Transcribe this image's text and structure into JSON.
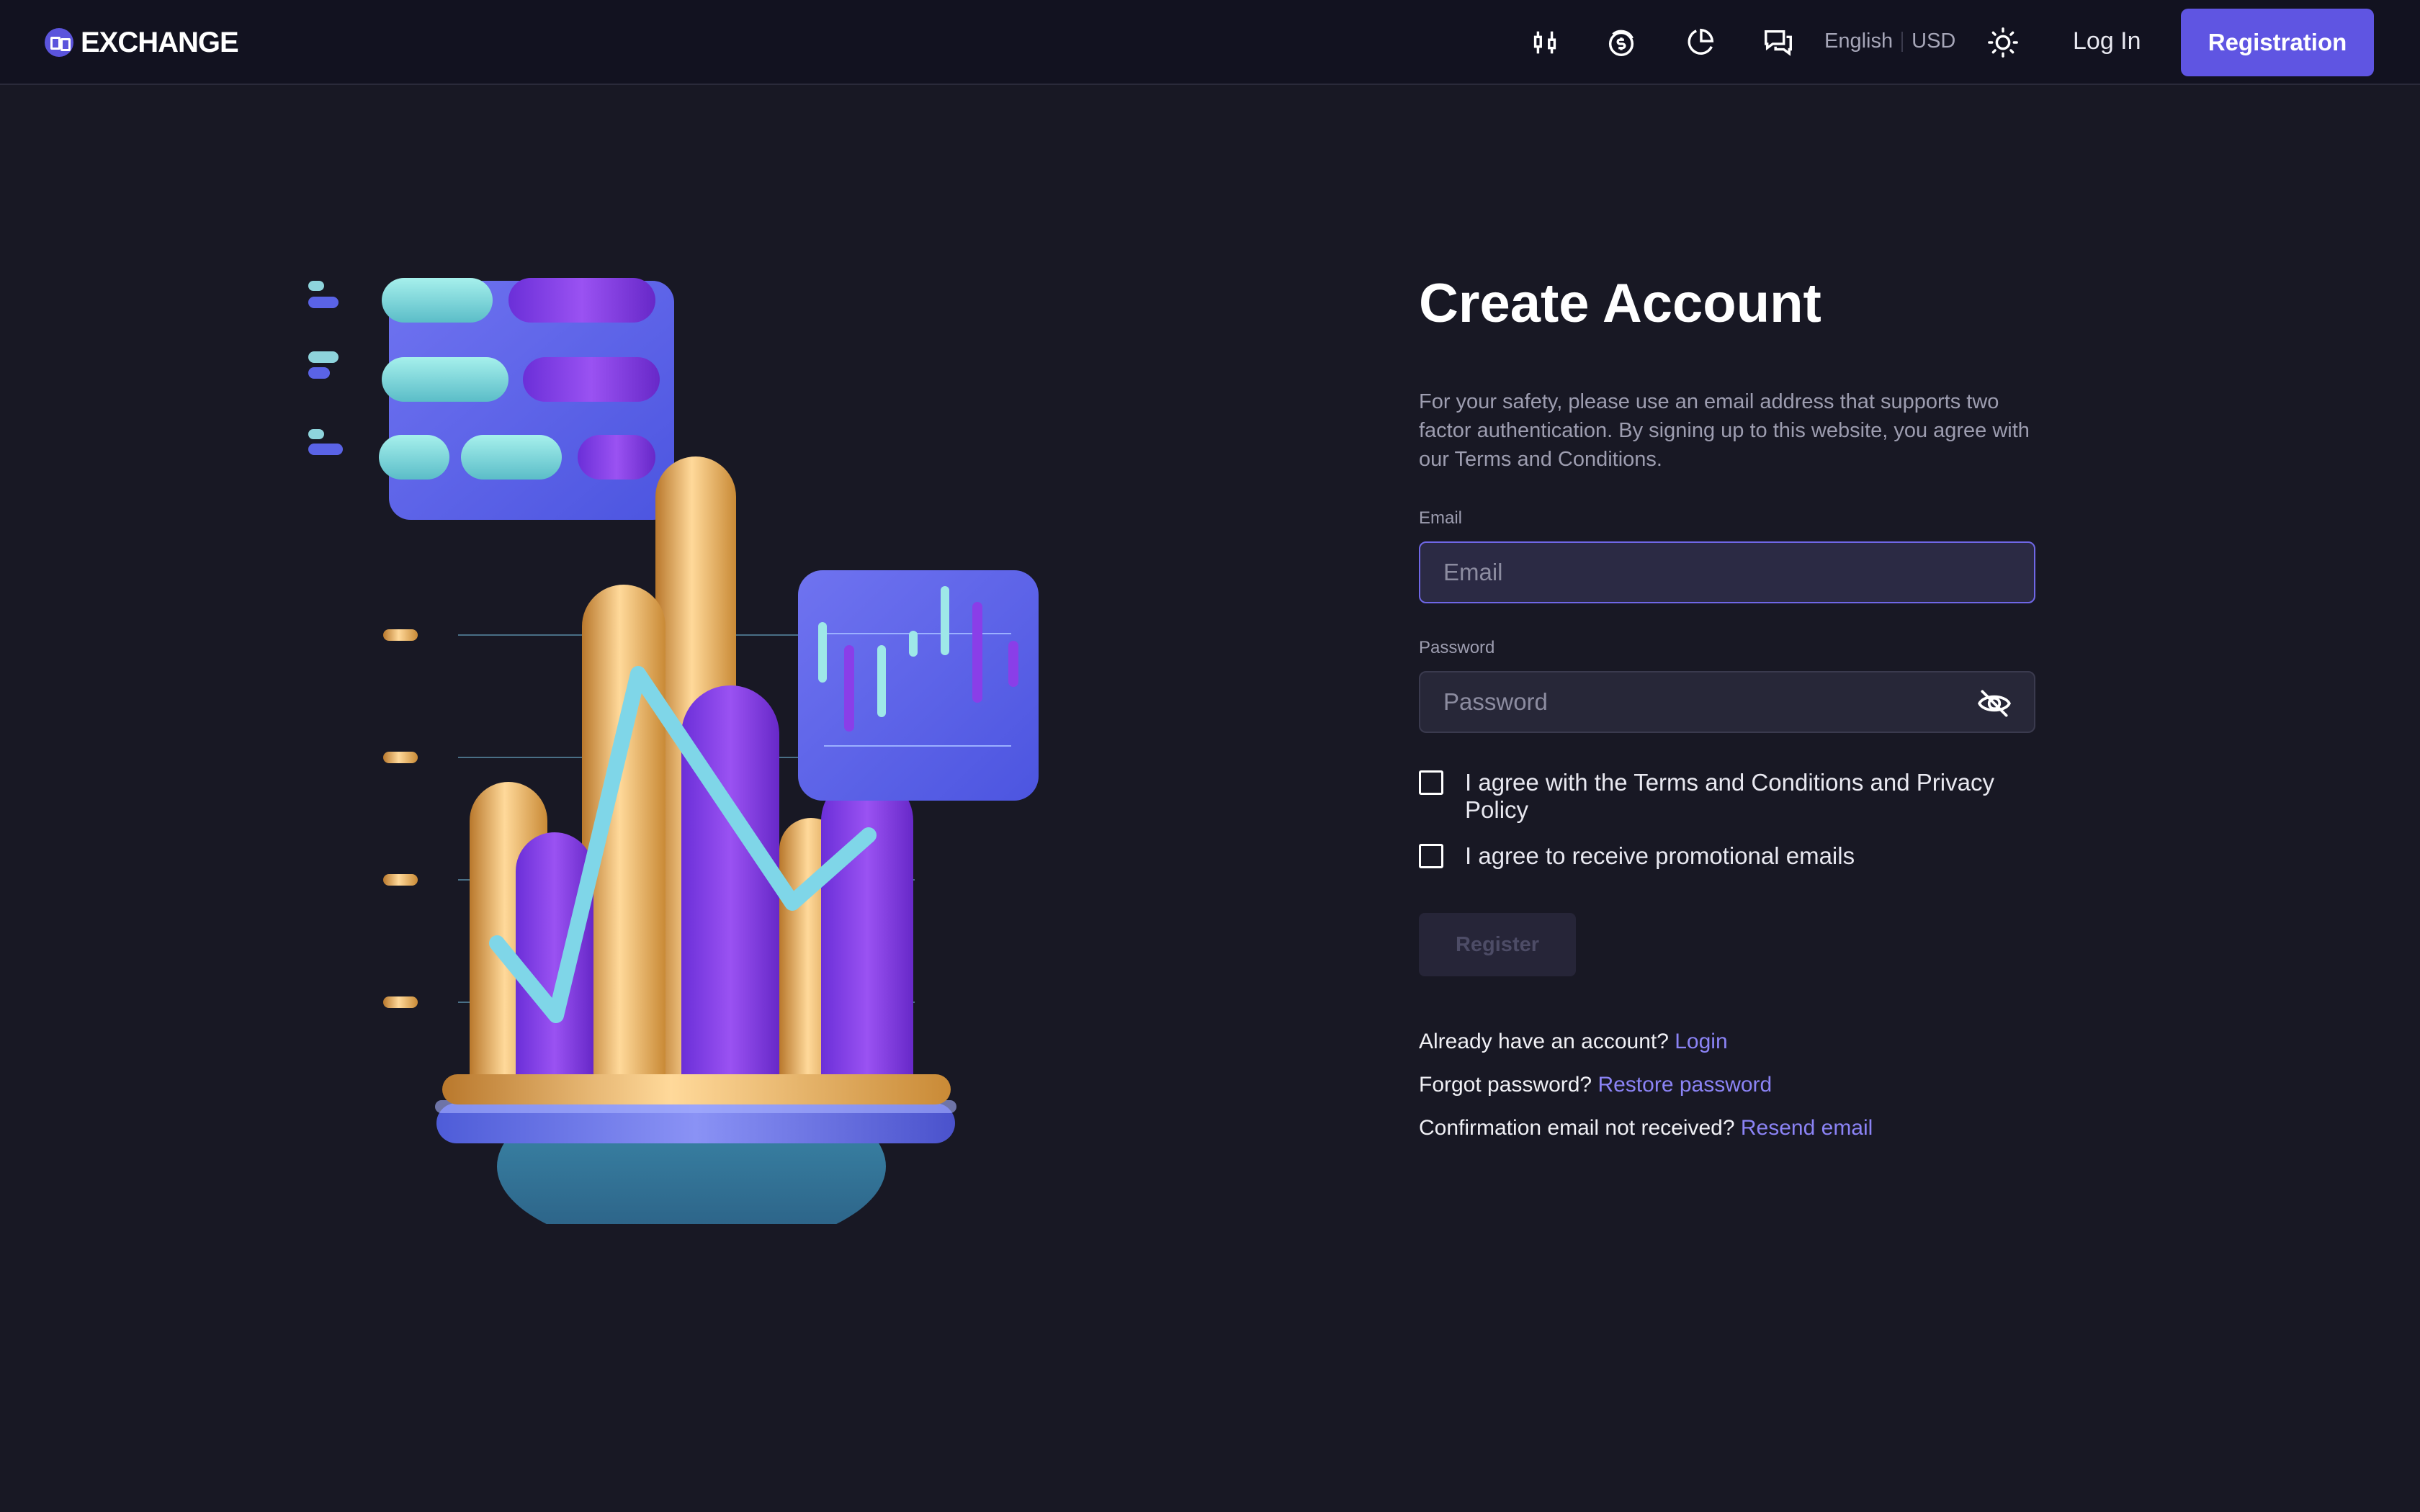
{
  "header": {
    "logo_text": "EXCHANGE",
    "icons": [
      "candlestick-icon",
      "coin-icon",
      "pie-chart-icon",
      "chat-icon",
      "sun-icon"
    ],
    "language": "English",
    "currency": "USD",
    "login_label": "Log In",
    "register_label": "Registration"
  },
  "form": {
    "title": "Create Account",
    "description": "For your safety, please use an email address that supports two factor authentication. By signing up to this website, you agree with our Terms and Conditions.",
    "email_label": "Email",
    "email_placeholder": "Email",
    "password_label": "Password",
    "password_placeholder": "Password",
    "terms_label": "I agree with the Terms and Conditions and Privacy Policy",
    "promo_label": "I agree to receive promotional emails",
    "register_label": "Register",
    "links": [
      {
        "text": "Already have an account?",
        "link": "Login"
      },
      {
        "text": "Forgot password?",
        "link": "Restore password"
      },
      {
        "text": "Confirmation email not received?",
        "link": "Resend email"
      }
    ]
  },
  "colors": {
    "background": "#181824",
    "header": "#121220",
    "accent": "#5f55e2",
    "link": "#8b83f5"
  }
}
